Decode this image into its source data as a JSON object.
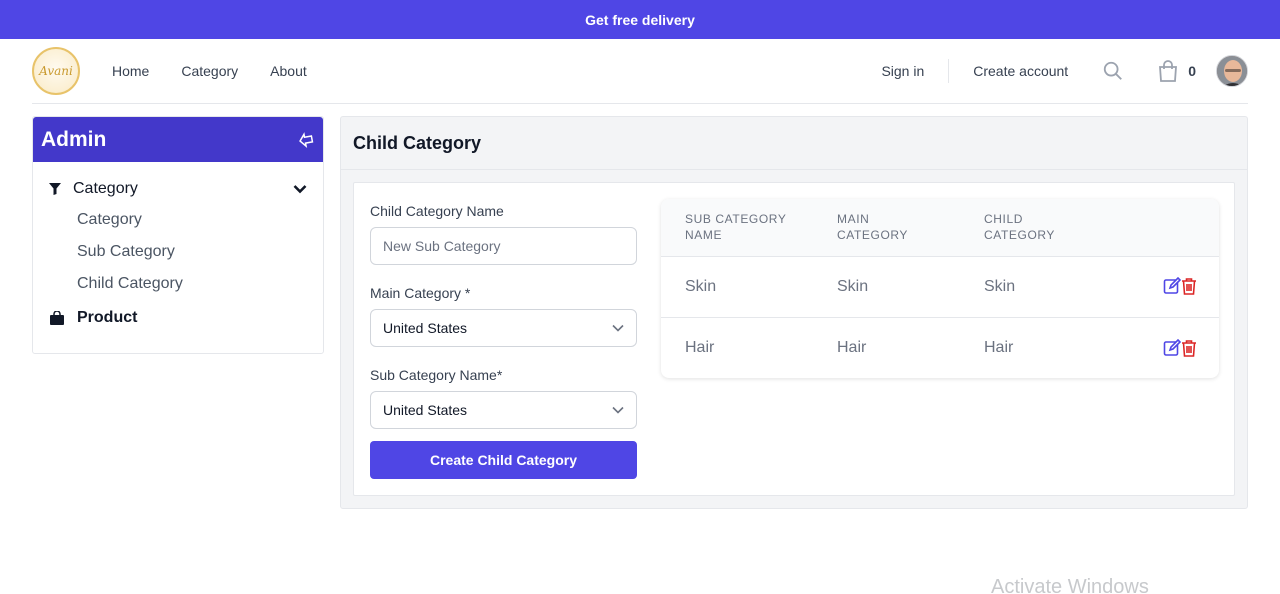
{
  "banner": {
    "text": "Get free delivery"
  },
  "header": {
    "logo_text": "Avani",
    "nav": [
      "Home",
      "Category",
      "About"
    ],
    "sign_in": "Sign in",
    "create_account": "Create account",
    "cart_count": "0"
  },
  "sidebar": {
    "title": "Admin",
    "sections": [
      {
        "label": "Category",
        "items": [
          "Category",
          "Sub Category",
          "Child Category"
        ]
      },
      {
        "label": "Product"
      }
    ]
  },
  "main": {
    "title": "Child Category",
    "form": {
      "name_label": "Child Category Name",
      "name_placeholder": "New Sub Category",
      "main_label": "Main Category *",
      "main_value": "United States",
      "sub_label": "Sub Category Name*",
      "sub_value": "United States",
      "submit_label": "Create Child Category"
    },
    "table": {
      "headers": [
        [
          "SUB CATEGORY",
          "NAME"
        ],
        [
          "MAIN",
          "CATEGORY"
        ],
        [
          "CHILD",
          "CATEGORY"
        ]
      ],
      "rows": [
        [
          "Skin",
          "Skin",
          "Skin"
        ],
        [
          "Hair",
          "Hair",
          "Hair"
        ]
      ]
    }
  },
  "watermark": "Activate Windows",
  "colors": {
    "accent": "#4f46e5",
    "sidebar_head": "#4338ca",
    "delete": "#dc2626"
  }
}
